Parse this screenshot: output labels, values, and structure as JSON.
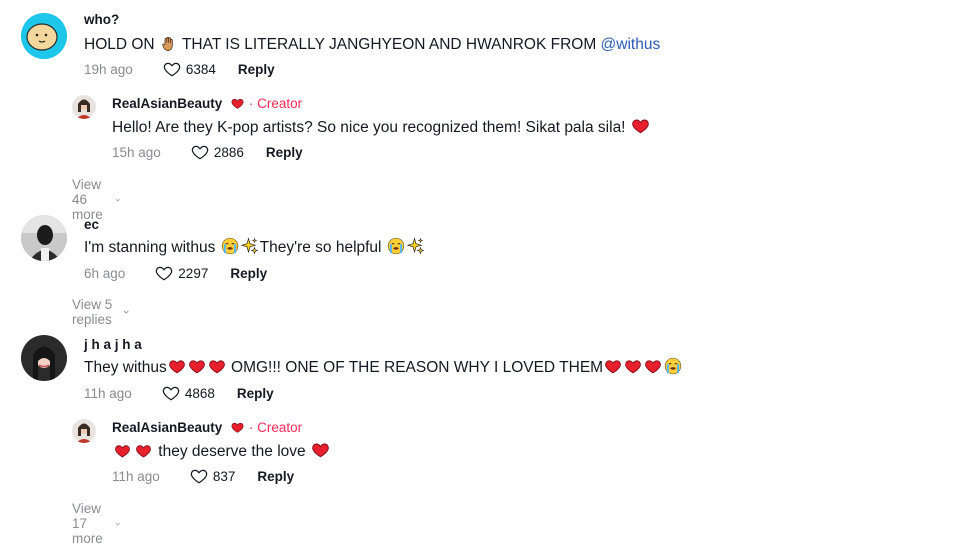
{
  "comments": [
    {
      "username": "who?",
      "text_before": "HOLD ON",
      "text_after": " THAT IS LITERALLY JANGHYEON AND HWANROK FROM ",
      "mention": "@withus",
      "time": "19h ago",
      "likes": "6384",
      "reply_label": "Reply",
      "replies": [
        {
          "username": "RealAsianBeauty",
          "creator_label": "· Creator",
          "text": "Hello! Are they K-pop artists? So nice you recognized them! Sikat pala sila!",
          "time": "15h ago",
          "likes": "2886",
          "reply_label": "Reply"
        }
      ],
      "view_more": "View 46 more"
    },
    {
      "username": "ec",
      "text_a": "I'm stanning withus",
      "text_b": "They're so helpful",
      "time": "6h ago",
      "likes": "2297",
      "reply_label": "Reply",
      "view_more": "View 5 replies"
    },
    {
      "username": "j h a j h a",
      "text_a": "They withus",
      "text_b": " OMG!!! ONE OF THE REASON WHY I LOVED THEM",
      "time": "11h ago",
      "likes": "4868",
      "reply_label": "Reply",
      "replies": [
        {
          "username": "RealAsianBeauty",
          "creator_label": "· Creator",
          "text": " they deserve the love ",
          "time": "11h ago",
          "likes": "837",
          "reply_label": "Reply"
        }
      ],
      "view_more": "View 17 more"
    }
  ],
  "colors": {
    "accent": "#fe2c55",
    "mention": "#2b5db9",
    "meta": "#8a8b91",
    "heart": "#e8202e"
  }
}
